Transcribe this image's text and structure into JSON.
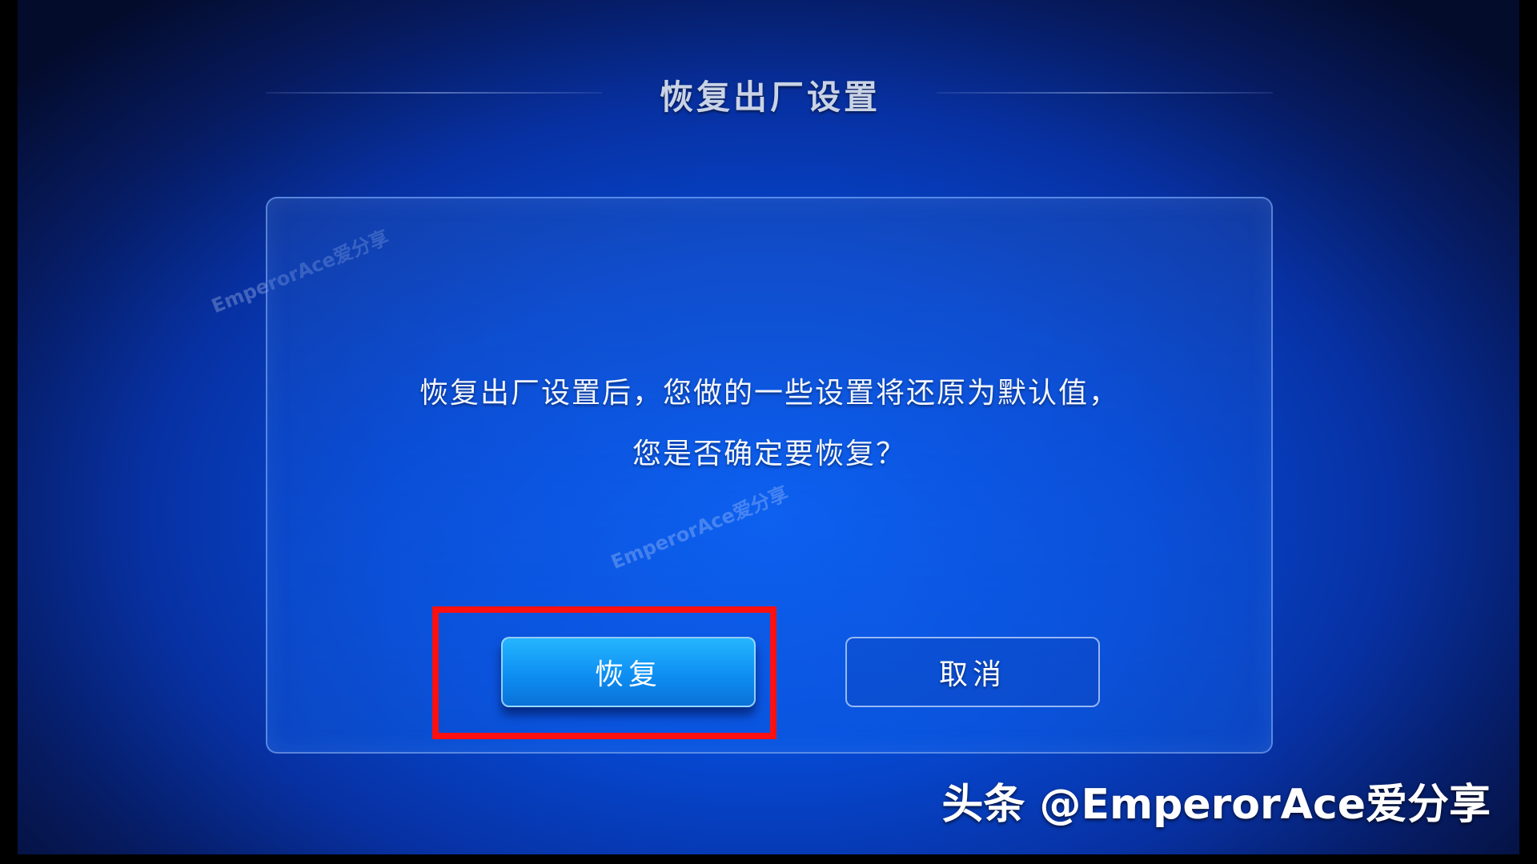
{
  "header": {
    "title": "恢复出厂设置"
  },
  "dialog": {
    "message_line1": "恢复出厂设置后，您做的一些设置将还原为默认值，",
    "message_line2": "您是否确定要恢复？",
    "restore_label": "恢复",
    "cancel_label": "取消"
  },
  "watermark": {
    "text": "EmperorAce爱分享"
  },
  "credit": {
    "text": "头条 @EmperorAce爱分享"
  },
  "colors": {
    "highlight": "#ff1010",
    "primary_button": "#0e8ef2",
    "background": "#0647cf"
  }
}
